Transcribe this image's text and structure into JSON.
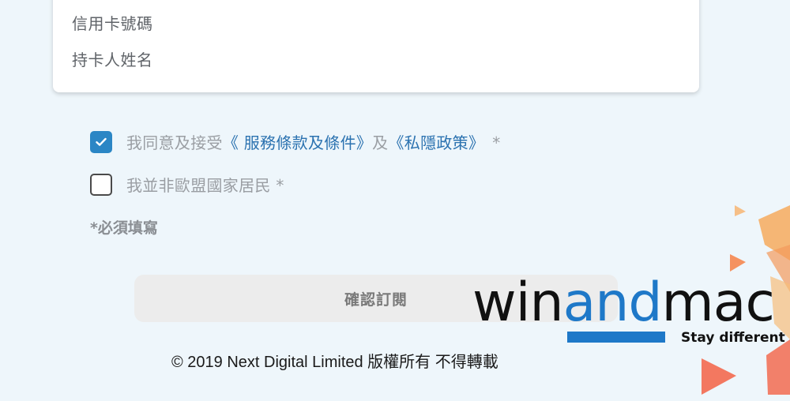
{
  "form": {
    "card_number_label": "信用卡號碼",
    "cardholder_name_label": "持卡人姓名"
  },
  "agreements": {
    "terms": {
      "checked": true,
      "prefix": "我同意及接受",
      "terms_link": "《 服務條款及條件》",
      "conjunction": "及",
      "privacy_link": "《私隱政策》",
      "required_mark": "*"
    },
    "non_eu": {
      "checked": false,
      "label": "我並非歐盟國家居民",
      "required_mark": "*"
    }
  },
  "required_note": "*必須填寫",
  "submit": {
    "label": "確認訂閱"
  },
  "footer": {
    "copyright": "© 2019 Next Digital Limited 版權所有 不得轉載"
  },
  "watermark": {
    "win": "win",
    "and": "and",
    "mac": "mac",
    "tagline": "Stay different"
  },
  "colors": {
    "accent": "#2b86c5",
    "link": "#2b72b0",
    "background": "#eef6fb",
    "watermark_blue": "#1e78c8"
  },
  "icons": {
    "checkbox_checked": "checkmark-icon"
  }
}
